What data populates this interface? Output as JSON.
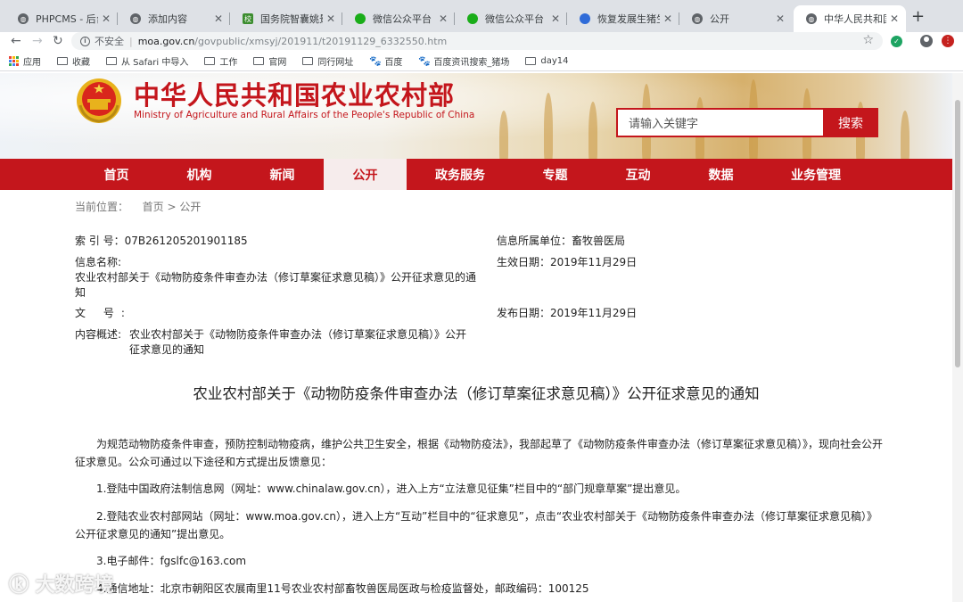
{
  "browser": {
    "tabs": [
      {
        "title": "PHPCMS - 后台管",
        "icon": "globe-icon"
      },
      {
        "title": "添加内容",
        "icon": "globe-icon"
      },
      {
        "title": "国务院智囊姚景源",
        "icon": "site-logo-icon"
      },
      {
        "title": "微信公众平台",
        "icon": "wechat-icon"
      },
      {
        "title": "微信公众平台",
        "icon": "wechat-icon"
      },
      {
        "title": "恢复发展生猪生产",
        "icon": "baidu-paw-icon"
      },
      {
        "title": "公开",
        "icon": "globe-icon"
      },
      {
        "title": "中华人民共和国农业",
        "icon": "globe-icon"
      }
    ],
    "address": {
      "insecure_label": "不安全",
      "host": "moa.gov.cn",
      "path": "/govpublic/xmsyj/201911/t20191129_6332550.htm"
    },
    "bookmarks": [
      "应用",
      "收藏",
      "从 Safari 中导入",
      "工作",
      "官网",
      "同行网址",
      "百度",
      "百度资讯搜索_猪场",
      "day14"
    ]
  },
  "site": {
    "title": "中华人民共和国农业农村部",
    "subtitle": "Ministry of Agriculture and Rural Affairs of the People's Republic of China",
    "search_placeholder": "请输入关键字",
    "search_button": "搜索",
    "nav": [
      "首页",
      "机构",
      "新闻",
      "公开",
      "政务服务",
      "专题",
      "互动",
      "数据",
      "业务管理"
    ],
    "active_nav": "公开",
    "brand_color": "#c4161c"
  },
  "breadcrumb": {
    "label": "当前位置：",
    "home": "首页",
    "sep": ">",
    "current": "公开"
  },
  "meta": {
    "index_label": "索 引 号：",
    "index_value": "07B261205201901185",
    "unit_label": "信息所属单位：",
    "unit_value": "畜牧兽医局",
    "name_label": "信息名称:",
    "name_value": "农业农村部关于《动物防疫条件审查办法（修订草案征求意见稿）》公开征求意见的通知",
    "effective_label": "生效日期：",
    "effective_value": "2019年11月29日",
    "docno_label": "文 号:",
    "docno_value": "",
    "publish_label": "发布日期：",
    "publish_value": "2019年11月29日",
    "summary_label": "内容概述:",
    "summary_value": "农业农村部关于《动物防疫条件审查办法（修订草案征求意见稿）》公开征求意见的通知"
  },
  "article": {
    "title": "农业农村部关于《动物防疫条件审查办法（修订草案征求意见稿）》公开征求意见的通知",
    "intro": "为规范动物防疫条件审查，预防控制动物疫病，维护公共卫生安全，根据《动物防疫法》，我部起草了《动物防疫条件审查办法（修订草案征求意见稿）》，现向社会公开征求意见。公众可通过以下途径和方式提出反馈意见：",
    "item1": "1.登陆中国政府法制信息网（网址：www.chinalaw.gov.cn），进入上方“立法意见征集”栏目中的“部门规章草案”提出意见。",
    "item2": "2.登陆农业农村部网站（网址：www.moa.gov.cn），进入上方“互动”栏目中的“征求意见”，点击“农业农村部关于《动物防疫条件审查办法（修订草案征求意见稿）》公开征求意见的通知”提出意见。",
    "item3": "3.电子邮件：fgslfc@163.com",
    "item4": "4.通信地址：北京市朝阳区农展南里11号农业农村部畜牧兽医局医政与检疫监督处，邮政编码：100125"
  },
  "watermark": "大数跨境"
}
